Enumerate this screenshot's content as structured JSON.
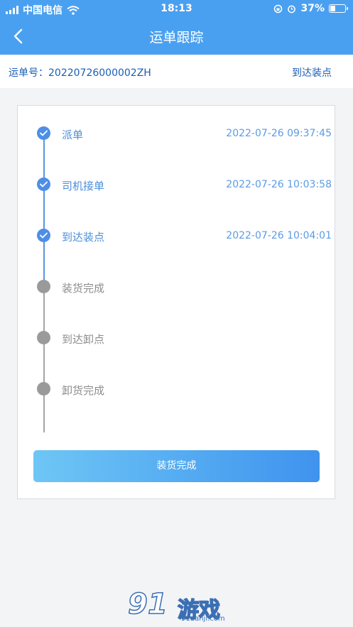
{
  "status_bar": {
    "carrier": "中国电信",
    "time": "18:13",
    "battery_percent": "37%",
    "battery_level": 0.37
  },
  "nav": {
    "title": "运单跟踪"
  },
  "order": {
    "label": "运单号：20220726000002ZH",
    "status": "到达装点"
  },
  "steps": [
    {
      "name": "派单",
      "time": "2022-07-26 09:37:45",
      "done": true
    },
    {
      "name": "司机接单",
      "time": "2022-07-26 10:03:58",
      "done": true
    },
    {
      "name": "到达装点",
      "time": "2022-07-26 10:04:01",
      "done": true
    },
    {
      "name": "装货完成",
      "time": "",
      "done": false
    },
    {
      "name": "到达卸点",
      "time": "",
      "done": false
    },
    {
      "name": "卸货完成",
      "time": "",
      "done": false
    }
  ],
  "action_button": {
    "label": "装货完成"
  },
  "watermark": {
    "logo": "9",
    "name": "游戏",
    "url": "91danji.com"
  },
  "colors": {
    "header": "#4aa0f0",
    "done": "#4d8ee6",
    "todo": "#9a9a9a",
    "line_done": "#5a95e0",
    "line_todo": "#a5a5a5"
  }
}
